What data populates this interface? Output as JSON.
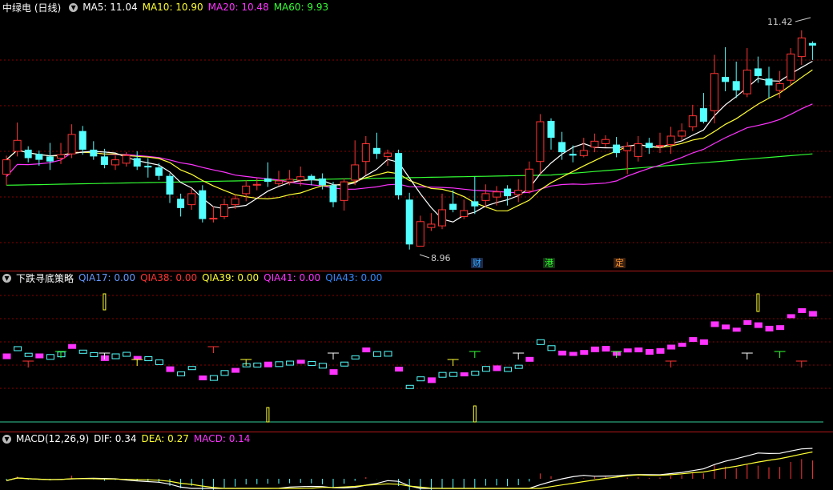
{
  "main": {
    "title": "中绿电 (日线)",
    "ma": [
      {
        "label": "MA5: 11.04",
        "color": "#ffffff"
      },
      {
        "label": "MA10: 10.90",
        "color": "#ffff33"
      },
      {
        "label": "MA20: 10.48",
        "color": "#ff33ff"
      },
      {
        "label": "MA60: 9.93",
        "color": "#33ff33"
      }
    ],
    "high_label": "11.42",
    "low_label": "8.96",
    "markers": [
      {
        "label": "财",
        "color": "#33aaff"
      },
      {
        "label": "港",
        "color": "#33ff33"
      },
      {
        "label": "定",
        "color": "#ff9933"
      }
    ]
  },
  "indicator": {
    "title": "下跌寻底策略",
    "items": [
      {
        "label": "QIA17: 0.00",
        "color": "#6699ff"
      },
      {
        "label": "QIA38: 0.00",
        "color": "#ff3333"
      },
      {
        "label": "QIA39: 0.00",
        "color": "#ffff33"
      },
      {
        "label": "QIA41: 0.00",
        "color": "#ff33ff"
      },
      {
        "label": "QIA43: 0.00",
        "color": "#3388ff"
      }
    ]
  },
  "macd": {
    "title": "MACD(12,26,9)",
    "items": [
      {
        "label": "DIF: 0.34",
        "color": "#ffffff"
      },
      {
        "label": "DEA: 0.27",
        "color": "#ffff33"
      },
      {
        "label": "MACD: 0.14",
        "color": "#ff33ff"
      }
    ]
  },
  "colors": {
    "up": "#ff3333",
    "down": "#54ffff",
    "grid": "#8a0000"
  },
  "chart_data": {
    "type": "candlestick",
    "candles": [
      [
        9.85,
        10.02,
        10.07,
        9.72
      ],
      [
        10.12,
        10.25,
        10.46,
        10.06
      ],
      [
        10.14,
        10.04,
        10.18,
        9.99
      ],
      [
        10.09,
        10.02,
        10.13,
        9.95
      ],
      [
        10.06,
        10.0,
        10.22,
        9.9
      ],
      [
        10.04,
        10.08,
        10.22,
        9.97
      ],
      [
        10.09,
        10.32,
        10.44,
        10.04
      ],
      [
        10.36,
        10.14,
        10.42,
        10.08
      ],
      [
        10.14,
        10.06,
        10.24,
        10.02
      ],
      [
        10.06,
        9.96,
        10.15,
        9.92
      ],
      [
        9.96,
        10.02,
        10.07,
        9.9
      ],
      [
        9.98,
        10.07,
        10.11,
        9.94
      ],
      [
        10.04,
        9.94,
        10.12,
        9.9
      ],
      [
        9.95,
        9.93,
        10.04,
        9.81
      ],
      [
        9.93,
        9.83,
        9.98,
        9.78
      ],
      [
        9.83,
        9.61,
        9.86,
        9.51
      ],
      [
        9.56,
        9.45,
        9.62,
        9.35
      ],
      [
        9.49,
        9.62,
        9.68,
        9.43
      ],
      [
        9.66,
        9.32,
        9.72,
        9.28
      ],
      [
        9.32,
        9.33,
        9.47,
        9.28
      ],
      [
        9.35,
        9.49,
        9.56,
        9.32
      ],
      [
        9.49,
        9.56,
        9.61,
        9.44
      ],
      [
        9.62,
        9.71,
        9.78,
        9.53
      ],
      [
        9.72,
        9.73,
        9.8,
        9.66
      ],
      [
        9.8,
        9.76,
        9.99,
        9.7
      ],
      [
        9.74,
        9.77,
        9.89,
        9.71
      ],
      [
        9.76,
        9.79,
        9.9,
        9.72
      ],
      [
        9.78,
        9.82,
        9.94,
        9.71
      ],
      [
        9.83,
        9.78,
        9.85,
        9.72
      ],
      [
        9.8,
        9.72,
        9.86,
        9.67
      ],
      [
        9.72,
        9.52,
        9.76,
        9.46
      ],
      [
        9.54,
        9.76,
        9.8,
        9.42
      ],
      [
        9.78,
        9.96,
        10.25,
        9.72
      ],
      [
        10.0,
        10.21,
        10.3,
        9.84
      ],
      [
        10.16,
        10.09,
        10.34,
        10.03
      ],
      [
        10.06,
        10.1,
        10.14,
        9.95
      ],
      [
        10.1,
        9.6,
        10.14,
        9.55
      ],
      [
        9.55,
        9.02,
        9.63,
        8.96
      ],
      [
        9.0,
        9.29,
        9.36,
        9.03
      ],
      [
        9.22,
        9.26,
        9.39,
        9.18
      ],
      [
        9.24,
        9.43,
        9.62,
        9.2
      ],
      [
        9.5,
        9.43,
        9.66,
        9.4
      ],
      [
        9.35,
        9.42,
        9.55,
        9.32
      ],
      [
        9.53,
        9.47,
        9.82,
        9.38
      ],
      [
        9.54,
        9.62,
        9.73,
        9.46
      ],
      [
        9.58,
        9.64,
        9.71,
        9.48
      ],
      [
        9.68,
        9.59,
        9.72,
        9.48
      ],
      [
        9.61,
        9.66,
        9.79,
        9.52
      ],
      [
        9.65,
        9.91,
        10.0,
        9.62
      ],
      [
        10.0,
        10.47,
        10.56,
        9.85
      ],
      [
        10.48,
        10.28,
        10.51,
        10.14
      ],
      [
        10.23,
        10.11,
        10.35,
        10.02
      ],
      [
        10.09,
        10.07,
        10.19,
        9.99
      ],
      [
        10.07,
        10.13,
        10.28,
        10.05
      ],
      [
        10.17,
        10.24,
        10.33,
        10.11
      ],
      [
        10.21,
        10.26,
        10.31,
        10.17
      ],
      [
        10.2,
        10.1,
        10.29,
        10.05
      ],
      [
        10.13,
        10.18,
        10.23,
        9.85
      ],
      [
        10.06,
        10.21,
        10.3,
        10.0
      ],
      [
        10.22,
        10.16,
        10.28,
        10.09
      ],
      [
        10.18,
        10.19,
        10.34,
        10.1
      ],
      [
        10.2,
        10.3,
        10.41,
        10.09
      ],
      [
        10.3,
        10.36,
        10.45,
        10.25
      ],
      [
        10.41,
        10.54,
        10.67,
        10.36
      ],
      [
        10.63,
        10.47,
        10.81,
        10.45
      ],
      [
        10.6,
        11.04,
        11.26,
        10.45
      ],
      [
        11.0,
        10.94,
        11.35,
        10.83
      ],
      [
        10.95,
        10.84,
        11.18,
        10.75
      ],
      [
        10.8,
        11.08,
        11.34,
        10.76
      ],
      [
        11.1,
        11.01,
        11.24,
        10.93
      ],
      [
        10.98,
        10.9,
        11.12,
        10.75
      ],
      [
        10.84,
        10.92,
        11.07,
        10.75
      ],
      [
        10.96,
        11.27,
        11.34,
        10.9
      ],
      [
        11.24,
        11.46,
        11.55,
        11.14
      ],
      [
        11.4,
        11.37,
        11.42,
        11.2
      ]
    ]
  }
}
